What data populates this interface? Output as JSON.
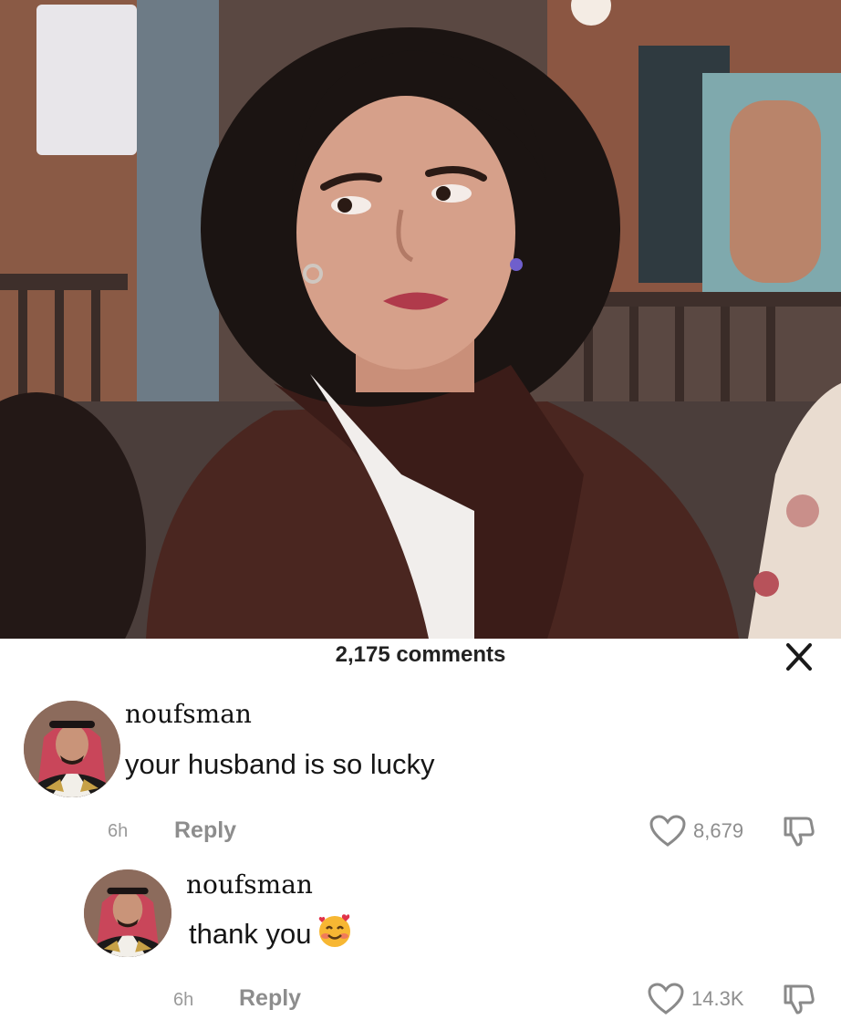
{
  "header": {
    "comment_count": "2,175 comments"
  },
  "comments": [
    {
      "username": "noufsman",
      "text": "your husband is so lucky",
      "time": "6h",
      "reply_label": "Reply",
      "likes": "8,679"
    },
    {
      "username": "noufsman",
      "text": "thank you",
      "emoji": "smiling-face-with-hearts",
      "time": "6h",
      "reply_label": "Reply",
      "likes": "14.3K"
    }
  ],
  "colors": {
    "muted": "#9a9a9a",
    "text": "#161616"
  }
}
